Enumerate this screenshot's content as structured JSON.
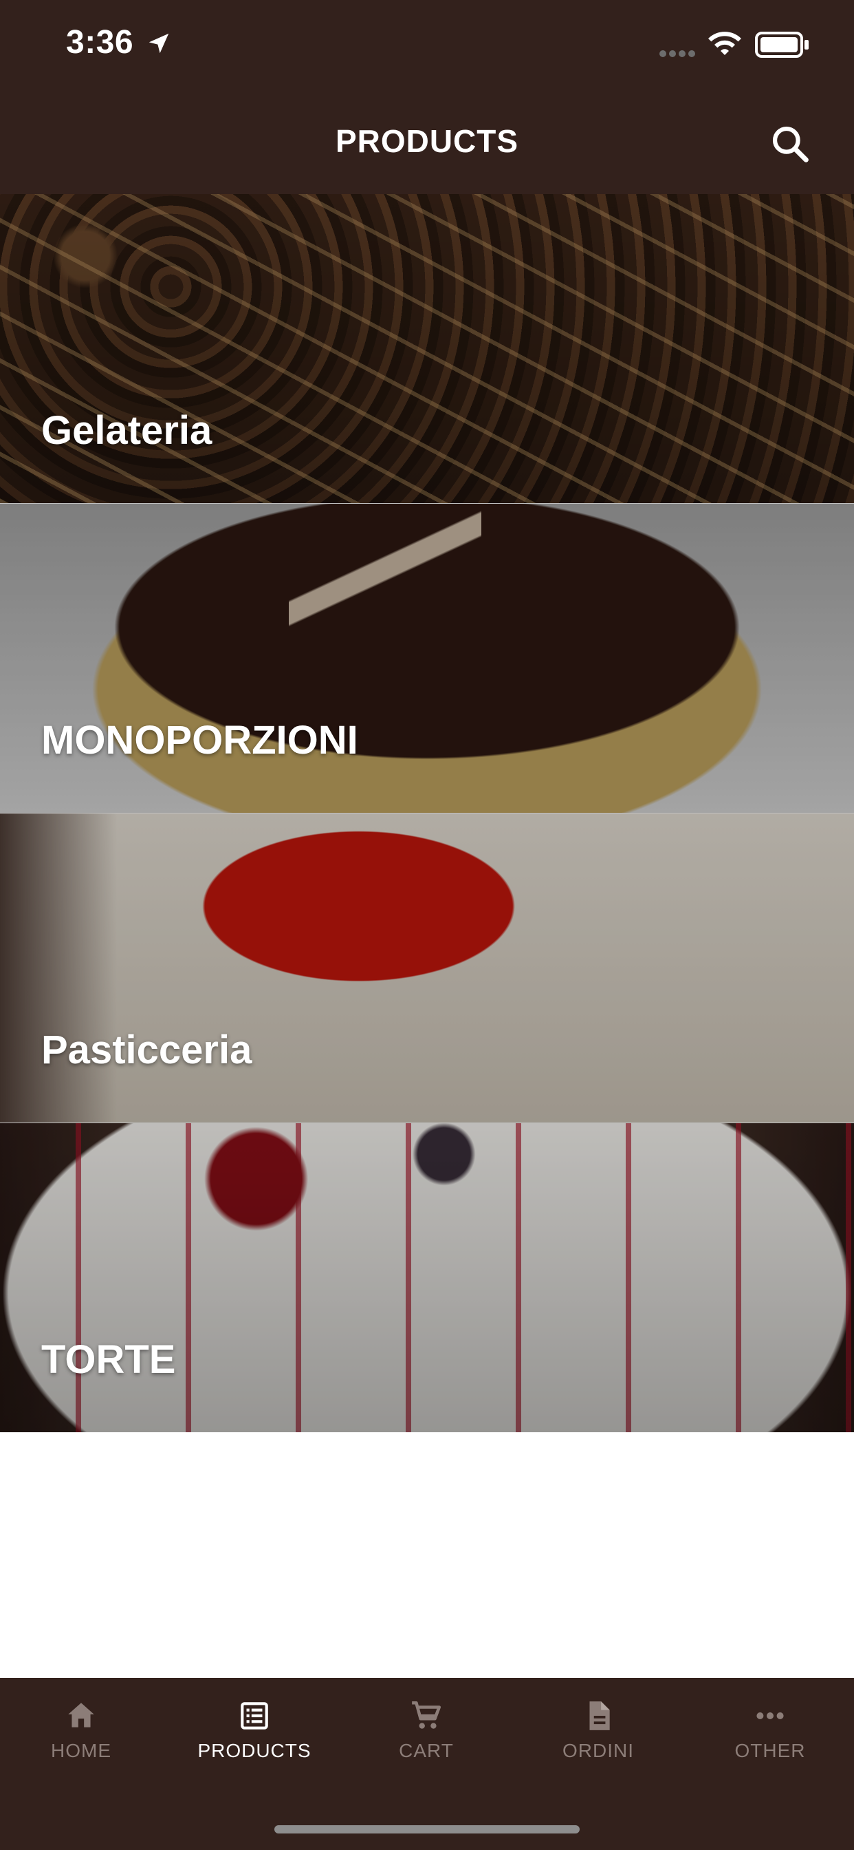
{
  "status_bar": {
    "time": "3:36",
    "icons": [
      "location-arrow-icon",
      "signal-dots-icon",
      "wifi-icon",
      "battery-icon"
    ]
  },
  "header": {
    "title": "PRODUCTS",
    "search_icon": "search-icon"
  },
  "categories": [
    {
      "label": "Gelateria"
    },
    {
      "label": "MONOPORZIONI"
    },
    {
      "label": "Pasticceria"
    },
    {
      "label": "TORTE"
    }
  ],
  "tabbar": {
    "items": [
      {
        "label": "HOME",
        "icon": "home-icon",
        "active": false
      },
      {
        "label": "PRODUCTS",
        "icon": "list-icon",
        "active": true
      },
      {
        "label": "CART",
        "icon": "cart-icon",
        "active": false
      },
      {
        "label": "ORDINI",
        "icon": "document-icon",
        "active": false
      },
      {
        "label": "OTHER",
        "icon": "more-icon",
        "active": false
      }
    ]
  },
  "colors": {
    "header_bg": "#33211c",
    "tab_inactive": "#8c7d78",
    "tab_active": "#ffffff"
  }
}
